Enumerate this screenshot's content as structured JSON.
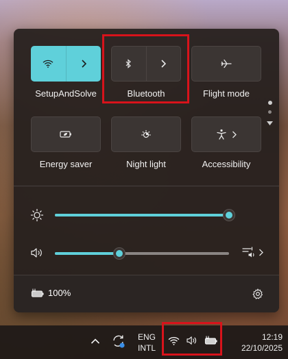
{
  "quick_settings": {
    "tiles": [
      {
        "label": "SetupAndSolve",
        "state": "on",
        "icon": "wifi-icon"
      },
      {
        "label": "Bluetooth",
        "state": "off",
        "icon": "bluetooth-icon"
      },
      {
        "label": "Flight mode",
        "state": "off",
        "icon": "airplane-icon"
      },
      {
        "label": "Energy saver",
        "state": "off",
        "icon": "battery-leaf-icon"
      },
      {
        "label": "Night light",
        "state": "off",
        "icon": "night-light-icon"
      },
      {
        "label": "Accessibility",
        "state": "off",
        "icon": "accessibility-icon"
      }
    ],
    "brightness": {
      "icon": "sun-icon",
      "level": 1.0
    },
    "volume": {
      "icon": "speaker-icon",
      "level": 0.37
    },
    "battery": {
      "percent": "100%"
    }
  },
  "taskbar": {
    "language_line1": "ENG",
    "language_line2": "INTL",
    "time": "12:19",
    "date": "22/10/2025"
  },
  "colors": {
    "accent": "#5fd0da",
    "panel": "#26201e",
    "highlight_box": "#d8131b"
  }
}
